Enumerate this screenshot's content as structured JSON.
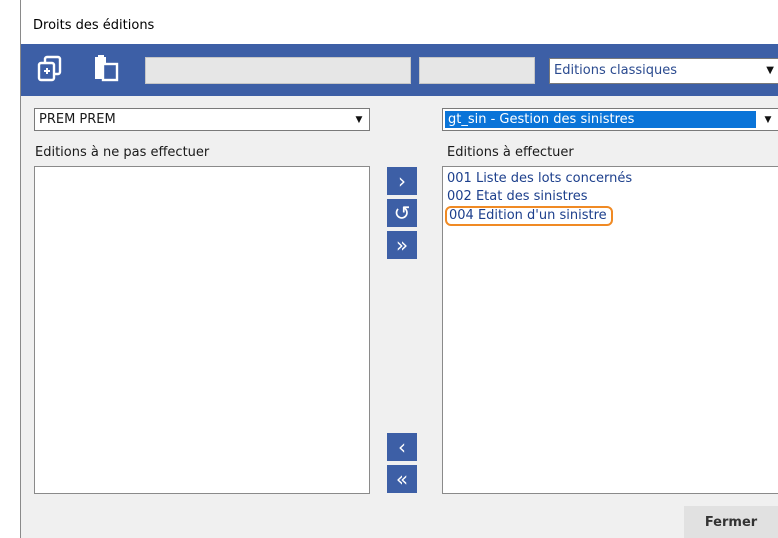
{
  "window": {
    "title": "Droits des éditions"
  },
  "toolbar": {
    "copy_icon": "copy-icon",
    "paste_icon": "paste-icon",
    "mode_select": "Editions classiques"
  },
  "left": {
    "user_select": "PREM PREM",
    "list_label": "Editions à ne pas effectuer",
    "items": []
  },
  "right": {
    "module_select": "gt_sin - Gestion des sinistres",
    "list_label": "Editions à effectuer",
    "items": [
      "001 Liste des lots concernés",
      "002 Etat des sinistres",
      "004 Edition d'un sinistre"
    ]
  },
  "move_buttons": {
    "add": "›",
    "refresh": "↺",
    "add_all": "»",
    "remove": "‹",
    "remove_all": "«"
  },
  "footer": {
    "close_label": "Fermer"
  },
  "colors": {
    "toolbar": "#3d5fa6",
    "highlight_border": "#f08a24",
    "selection": "#0a74d8"
  }
}
